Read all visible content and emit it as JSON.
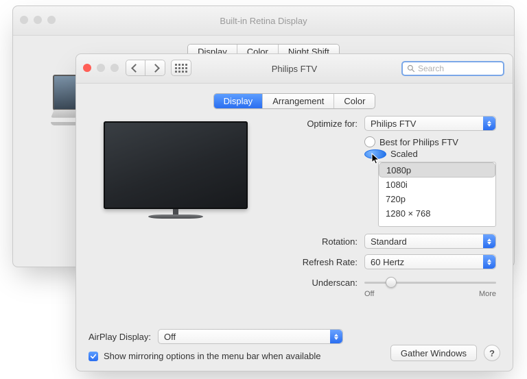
{
  "back_window": {
    "title": "Built-in Retina Display",
    "tabs": [
      "Display",
      "Color",
      "Night Shift"
    ],
    "selected_tab": 0
  },
  "front_window": {
    "title": "Philips FTV",
    "search_placeholder": "Search",
    "tabs": [
      "Display",
      "Arrangement",
      "Color"
    ],
    "selected_tab": 0,
    "optimize_label": "Optimize for:",
    "optimize_value": "Philips FTV",
    "radio_best": "Best for Philips FTV",
    "radio_scaled": "Scaled",
    "radio_selected": "scaled",
    "scaled_options": [
      "1080p",
      "1080i",
      "720p",
      "1280 × 768"
    ],
    "scaled_selected_index": 0,
    "rotation_label": "Rotation:",
    "rotation_value": "Standard",
    "refresh_label": "Refresh Rate:",
    "refresh_value": "60 Hertz",
    "underscan_label": "Underscan:",
    "underscan_min": "Off",
    "underscan_max": "More",
    "underscan_pos_pct": 20,
    "airplay_label": "AirPlay Display:",
    "airplay_value": "Off",
    "mirroring_checkbox": "Show mirroring options in the menu bar when available",
    "mirroring_checked": true,
    "gather_button": "Gather Windows"
  }
}
